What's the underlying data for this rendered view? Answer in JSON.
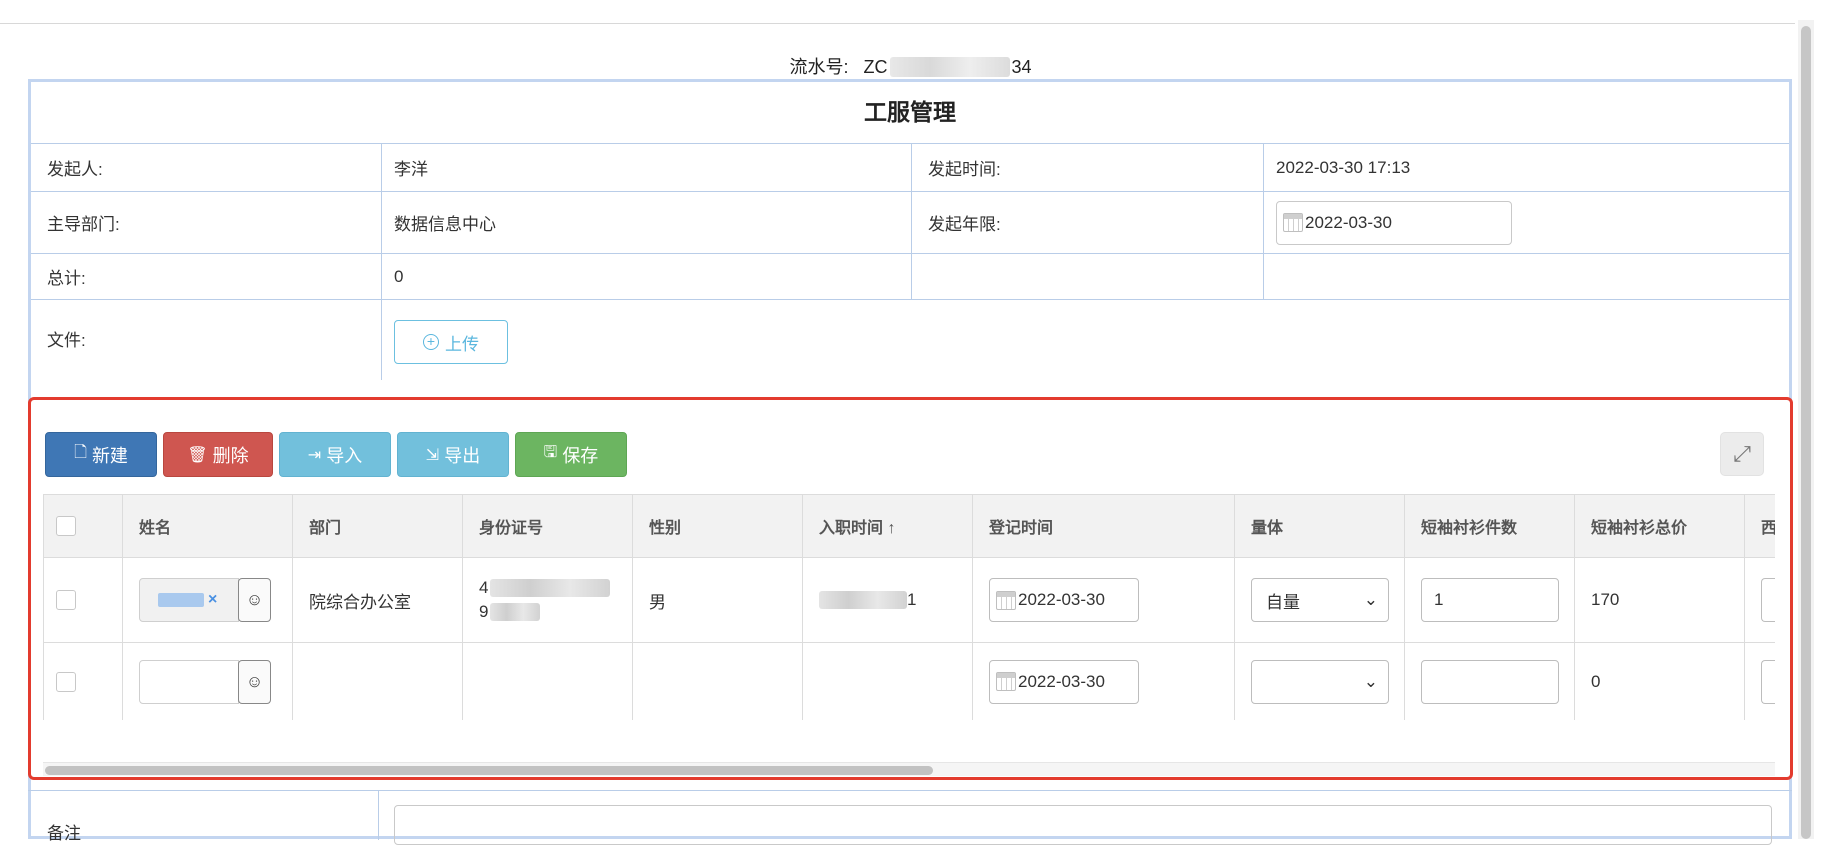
{
  "serial": {
    "label": "流水号:",
    "prefix": "ZC",
    "suffix": "34"
  },
  "form": {
    "title": "工服管理",
    "rows": {
      "initiator_label": "发起人:",
      "initiator_value": "李洋",
      "time_label": "发起时间:",
      "time_value": "2022-03-30 17:13",
      "dept_label": "主导部门:",
      "dept_value": "数据信息中心",
      "year_label": "发起年限:",
      "year_value": "2022-03-30",
      "total_label": "总计:",
      "total_value": "0",
      "file_label": "文件:",
      "upload_label": "上传"
    }
  },
  "toolbar": {
    "new_label": "新建",
    "delete_label": "删除",
    "import_label": "导入",
    "export_label": "导出",
    "save_label": "保存"
  },
  "table": {
    "headers": [
      "姓名",
      "部门",
      "身份证号",
      "性别",
      "入职时间 ↑",
      "登记时间",
      "量体",
      "短袖衬衫件数",
      "短袖衬衫总价",
      "西"
    ],
    "rows": [
      {
        "dept": "院综合办公室",
        "id_prefix_1": "4",
        "id_prefix_2": "9",
        "gender": "男",
        "hire_suffix": "1",
        "reg_date": "2022-03-30",
        "measure": "自量",
        "shirt_count": "1",
        "shirt_total": "170"
      },
      {
        "dept": "",
        "gender": "",
        "reg_date": "2022-03-30",
        "measure": "",
        "shirt_count": "",
        "shirt_total": "0"
      }
    ]
  },
  "remark": {
    "label": "备注"
  },
  "icons": {
    "calendar": "calendar-icon",
    "user": "user-icon",
    "expand": "expand-icon"
  },
  "colors": {
    "primary": "#3f77b5",
    "danger": "#cf5650",
    "info": "#72c0dc",
    "success": "#6cb561",
    "highlight": "#e33b2e"
  }
}
